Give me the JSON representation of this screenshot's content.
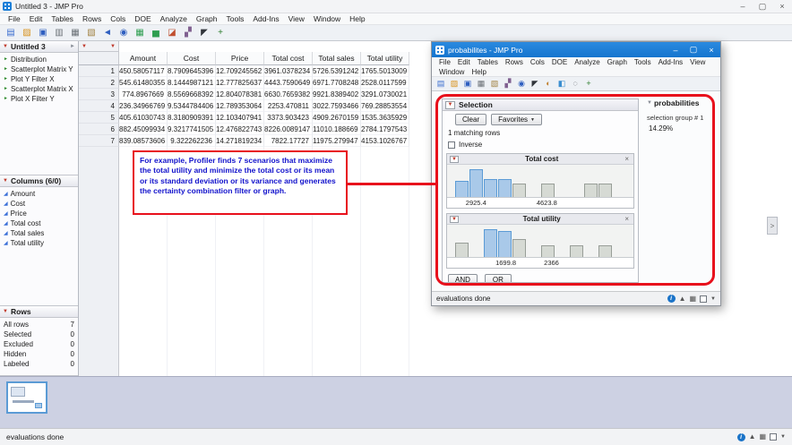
{
  "main_window": {
    "title": "Untitled 3 - JMP Pro",
    "menus": [
      "File",
      "Edit",
      "Tables",
      "Rows",
      "Cols",
      "DOE",
      "Analyze",
      "Graph",
      "Tools",
      "Add-Ins",
      "View",
      "Window",
      "Help"
    ],
    "toolbar_icons": [
      {
        "name": "new-table-icon",
        "glyph": "▤",
        "color": "#3a6ed0"
      },
      {
        "name": "open-icon",
        "glyph": "▨",
        "color": "#d89018"
      },
      {
        "name": "save-icon",
        "glyph": "▣",
        "color": "#2f5fc0"
      },
      {
        "name": "print-icon",
        "glyph": "▥",
        "color": "#6a7076"
      },
      {
        "name": "copy-icon",
        "glyph": "▦",
        "color": "#6a7076"
      },
      {
        "name": "paste-icon",
        "glyph": "▧",
        "color": "#a08040"
      },
      {
        "name": "undo-icon",
        "glyph": "◄",
        "color": "#2f5fc0"
      },
      {
        "name": "zoom-icon",
        "glyph": "◉",
        "color": "#2f5fc0"
      },
      {
        "name": "table-icon",
        "glyph": "▦",
        "color": "#2e9e50"
      },
      {
        "name": "chart-icon",
        "glyph": "▅",
        "color": "#2e9e50"
      },
      {
        "name": "profiler-icon",
        "glyph": "◪",
        "color": "#c05030"
      },
      {
        "name": "script-icon",
        "glyph": "▞",
        "color": "#806090"
      },
      {
        "name": "arrow-tool-icon",
        "glyph": "◤",
        "color": "#30343a"
      },
      {
        "name": "add-icon",
        "glyph": "+",
        "color": "#2e7e2e"
      }
    ],
    "status_bar": "evaluations done"
  },
  "sidebar": {
    "table_panel": {
      "title": "Untitled 3",
      "items": [
        "Distribution",
        "Scatterplot Matrix Y",
        "Plot Y Filter X",
        "Scatterplot Matrix X",
        "Plot X Filter Y"
      ]
    },
    "columns_panel": {
      "title": "Columns (6/0)",
      "items": [
        "Amount",
        "Cost",
        "Price",
        "Total cost",
        "Total sales",
        "Total utility"
      ]
    },
    "rows_panel": {
      "title": "Rows",
      "stats": [
        {
          "label": "All rows",
          "value": "7"
        },
        {
          "label": "Selected",
          "value": "0"
        },
        {
          "label": "Excluded",
          "value": "0"
        },
        {
          "label": "Hidden",
          "value": "0"
        },
        {
          "label": "Labeled",
          "value": "0"
        }
      ]
    }
  },
  "table": {
    "columns": [
      "Amount",
      "Cost",
      "Price",
      "Total cost",
      "Total sales",
      "Total utility"
    ],
    "rows": [
      [
        "450.58057117",
        "8.7909645396",
        "12.709245562",
        "3961.0378234",
        "5726.5391242",
        "1765.5013009"
      ],
      [
        "545.61480355",
        "8.1444987121",
        "12.777825637",
        "4443.7590649",
        "6971.7708248",
        "2528.0117599"
      ],
      [
        "774.8967669",
        "8.5569668392",
        "12.804078381",
        "6630.7659382",
        "9921.8389402",
        "3291.0730021"
      ],
      [
        "236.34966769",
        "9.5344784406",
        "12.789353064",
        "2253.470811",
        "3022.7593466",
        "769.28853554"
      ],
      [
        "405.61030743",
        "8.3180909391",
        "12.103407941",
        "3373.903423",
        "4909.2670159",
        "1535.3635929"
      ],
      [
        "882.45099934",
        "9.3217741505",
        "12.476822743",
        "8226.0089147",
        "11010.188669",
        "2784.1797543"
      ],
      [
        "839.08573606",
        "9.322262236",
        "14.271819234",
        "7822.17727",
        "11975.279947",
        "4153.1026767"
      ]
    ]
  },
  "annotation": {
    "text": "For example, Profiler finds 7 scenarios that maximize the total utility and minimize the total cost or its mean or its standard deviation or its variance and generates the certainty combination filter or graph."
  },
  "child_window": {
    "title": "probabilites - JMP Pro",
    "menus_row1": [
      "File",
      "Edit",
      "Tables",
      "Rows",
      "Cols",
      "DOE",
      "Analyze",
      "Graph",
      "Tools",
      "Add-Ins",
      "View"
    ],
    "menus_row2": [
      "Window",
      "Help"
    ],
    "toolbar_icons": [
      {
        "name": "new-table-icon",
        "glyph": "▤",
        "color": "#3a6ed0"
      },
      {
        "name": "open-icon",
        "glyph": "▨",
        "color": "#d89018"
      },
      {
        "name": "save-icon",
        "glyph": "▣",
        "color": "#2f5fc0"
      },
      {
        "name": "copy-icon",
        "glyph": "▦",
        "color": "#6a7076"
      },
      {
        "name": "paste-icon",
        "glyph": "▧",
        "color": "#a08040"
      },
      {
        "name": "script-icon",
        "glyph": "▞",
        "color": "#806090"
      },
      {
        "name": "zoom-icon",
        "glyph": "◉",
        "color": "#2f5fc0"
      },
      {
        "name": "arrow-tool-icon",
        "glyph": "◤",
        "color": "#30343a"
      },
      {
        "name": "hand-tool-icon",
        "glyph": "◐",
        "color": "#c08030"
      },
      {
        "name": "brush-tool-icon",
        "glyph": "◧",
        "color": "#3a8ed0"
      },
      {
        "name": "lasso-tool-icon",
        "glyph": "◌",
        "color": "#30343a"
      },
      {
        "name": "add-icon",
        "glyph": "+",
        "color": "#2e7e2e"
      }
    ],
    "selection": {
      "title": "Selection",
      "clear_label": "Clear",
      "favorites_label": "Favorites",
      "matching_text": "1 matching rows",
      "inverse_label": "Inverse",
      "filters": [
        {
          "title": "Total cost",
          "min": "2925.4",
          "max": "4623.8",
          "bins": [
            {
              "h": 0.55,
              "s": 1
            },
            {
              "h": 0.95,
              "s": 1
            },
            {
              "h": 0.6,
              "s": 1
            },
            {
              "h": 0.6,
              "s": 1
            },
            {
              "h": 0.45,
              "s": 0
            },
            {
              "h": 0,
              "s": 0
            },
            {
              "h": 0.45,
              "s": 0
            },
            {
              "h": 0,
              "s": 0
            },
            {
              "h": 0,
              "s": 0
            },
            {
              "h": 0.45,
              "s": 0
            },
            {
              "h": 0.45,
              "s": 0
            },
            {
              "h": 0,
              "s": 0
            }
          ]
        },
        {
          "title": "Total utility",
          "min": "1699.8",
          "max": "2366",
          "bins": [
            {
              "h": 0.5,
              "s": 0
            },
            {
              "h": 0,
              "s": 0
            },
            {
              "h": 0.95,
              "s": 1
            },
            {
              "h": 0.88,
              "s": 1
            },
            {
              "h": 0.6,
              "s": 0
            },
            {
              "h": 0,
              "s": 0
            },
            {
              "h": 0.4,
              "s": 0
            },
            {
              "h": 0,
              "s": 0
            },
            {
              "h": 0.4,
              "s": 0
            },
            {
              "h": 0,
              "s": 0
            },
            {
              "h": 0.4,
              "s": 0
            },
            {
              "h": 0,
              "s": 0
            }
          ]
        }
      ],
      "and_label": "AND",
      "or_label": "OR"
    },
    "probabilities_panel": {
      "title": "probabilities",
      "group_label": "selection group # 1",
      "value": "14.29%"
    },
    "status": "evaluations done"
  },
  "colors": {
    "accent_blue": "#1d7fd8",
    "annotation_red": "#e8101c",
    "annotation_text_blue": "#1212cc",
    "histogram_selected": "#a9c9e9",
    "histogram_unselected": "#d6dad4"
  },
  "icons": {
    "minimize": "–",
    "maximize": "▢",
    "close": "×",
    "caret": "▼",
    "hotspot": "▼",
    "chevron": ">",
    "green_arrow": "►",
    "column_icon": "◢",
    "panel_collapse": "►",
    "gray_triangle": "▼",
    "info": "i",
    "up": "▲",
    "grid": "▦"
  }
}
